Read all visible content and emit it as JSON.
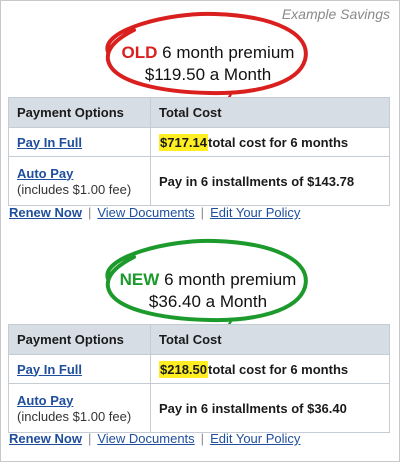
{
  "caption": "Example Savings",
  "colors": {
    "old": "#d9201f",
    "new": "#1c9a2c",
    "highlight": "#ffee22",
    "link": "#1f4e9d"
  },
  "old": {
    "tag": "OLD",
    "headline": "6 month premium",
    "monthly": "$119.50 a Month",
    "table": {
      "headers": [
        "Payment Options",
        "Total Cost"
      ],
      "rows": [
        {
          "option": "Pay In Full",
          "note": "",
          "amount": "$717.14",
          "cost": "total cost for 6 months"
        },
        {
          "option": "Auto Pay",
          "note": "(includes $1.00 fee)",
          "amount": "",
          "cost": "Pay in 6 installments of $143.78"
        }
      ]
    },
    "links": [
      "Renew Now",
      "View Documents",
      "Edit Your Policy"
    ]
  },
  "new": {
    "tag": "NEW",
    "headline": "6 month premium",
    "monthly": "$36.40 a Month",
    "table": {
      "headers": [
        "Payment Options",
        "Total Cost"
      ],
      "rows": [
        {
          "option": "Pay In Full",
          "note": "",
          "amount": "$218.50",
          "cost": "total cost for 6 months"
        },
        {
          "option": "Auto Pay",
          "note": "(includes $1.00 fee)",
          "amount": "",
          "cost": "Pay in 6 installments of $36.40"
        }
      ]
    },
    "links": [
      "Renew Now",
      "View Documents",
      "Edit Your Policy"
    ]
  },
  "separator": "|"
}
